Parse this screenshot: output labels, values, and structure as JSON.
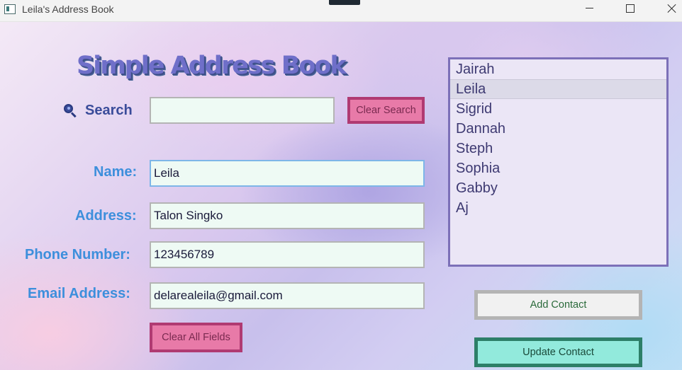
{
  "window": {
    "title": "Leila's Address Book",
    "controls": [
      "minimize",
      "maximize",
      "close"
    ]
  },
  "app": {
    "heading": "Simple Address Book"
  },
  "search": {
    "label": "Search",
    "value": "",
    "icon": "magnifier-icon",
    "clear_label": "Clear Search"
  },
  "form": {
    "name_label": "Name:",
    "name_value": "Leila",
    "address_label": "Address:",
    "address_value": "Talon Singko",
    "phone_label": "Phone Number:",
    "phone_value": "123456789",
    "email_label": "Email Address:",
    "email_value": "delarealeila@gmail.com",
    "clear_all_label": "Clear All Fields"
  },
  "contacts": {
    "items": [
      "Jairah",
      "Leila",
      "Sigrid",
      "Dannah",
      "Steph",
      "Sophia",
      "Gabby",
      "Aj"
    ],
    "selected": "Leila"
  },
  "actions": {
    "add_label": "Add Contact",
    "update_label": "Update Contact"
  },
  "colors": {
    "label_blue": "#3d8fdc",
    "search_label": "#3a4c9a",
    "pink_button": "#e87aa8",
    "pink_border": "#b03a72",
    "update_button": "#92eadc",
    "update_border": "#2d7f68",
    "list_border": "#7c70b8",
    "input_bg": "#eefaf4"
  }
}
